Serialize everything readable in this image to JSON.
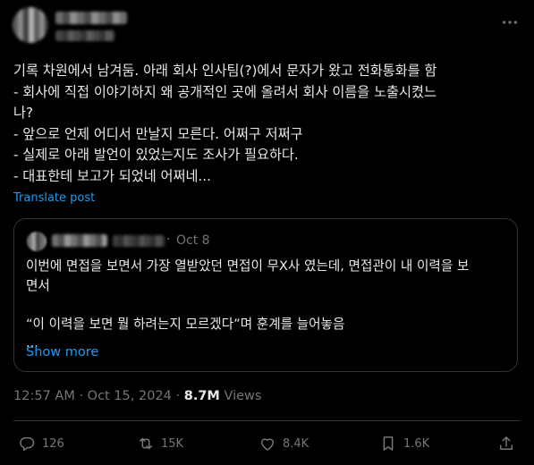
{
  "tweet": {
    "lines": [
      "기록 차원에서 남겨둠. 아래 회사 인사팀(?)에서 문자가 왔고 전화통화를 함",
      "- 회사에 직접 이야기하지 왜 공개적인 곳에 올려서 회사 이름을 노출시켰느",
      "나?",
      "- 앞으로 언제 어디서 만날지 모른다. 어쩌구 저쩌구",
      "- 실제로 아래 발언이 있었는지도 조사가 필요하다.",
      "- 대표한테 보고가 되었네 어쩌네..."
    ],
    "translate_label": "Translate post"
  },
  "quote": {
    "separator": "·",
    "date": "Oct 8",
    "lines": [
      "이번에 면접을 보면서 가장 열받았던 면접이 무X사 였는데, 면접관이 내 이력을 보",
      "면서",
      "",
      "“이 이력을 보면 뭘 하려는지 모르겠다”며 훈계를 늘어놓음",
      "..."
    ],
    "show_more": "Show more"
  },
  "meta": {
    "time": "12:57 AM",
    "separator": "·",
    "date": "Oct 15, 2024",
    "views_count": "8.7M",
    "views_label": "Views"
  },
  "actions": {
    "replies": "126",
    "reposts": "15K",
    "likes": "8.4K",
    "bookmarks": "1.6K"
  },
  "colors": {
    "background": "#000000",
    "text": "#e7e9ea",
    "muted": "#71767b",
    "accent": "#1d9bf0",
    "border": "#2f3336"
  }
}
